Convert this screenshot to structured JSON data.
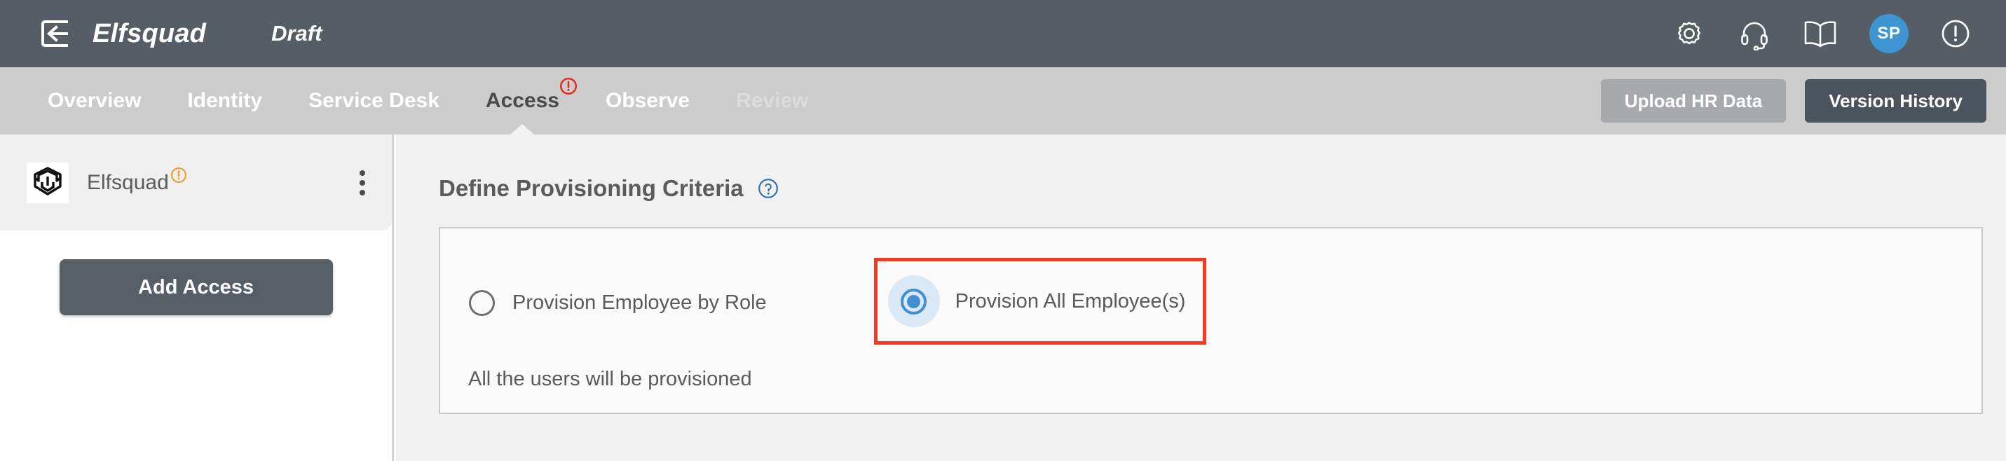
{
  "header": {
    "back_icon": "back-arrow-box-icon",
    "brand": "Elfsquad",
    "status": "Draft",
    "icons": [
      {
        "name": "gear-icon",
        "label": "Settings"
      },
      {
        "name": "headset-icon",
        "label": "Support"
      },
      {
        "name": "book-icon",
        "label": "Documentation"
      }
    ],
    "avatar_initials": "SP",
    "alert_icon": "exclamation-circle-icon"
  },
  "nav": {
    "tabs": [
      {
        "label": "Overview",
        "state": "normal"
      },
      {
        "label": "Identity",
        "state": "normal"
      },
      {
        "label": "Service Desk",
        "state": "normal"
      },
      {
        "label": "Access",
        "state": "active",
        "warning": true
      },
      {
        "label": "Observe",
        "state": "normal"
      },
      {
        "label": "Review",
        "state": "disabled"
      }
    ],
    "actions": {
      "upload_label": "Upload HR Data",
      "version_label": "Version History"
    }
  },
  "sidebar": {
    "org": {
      "logo_icon": "elfsquad-shield-logo-icon",
      "name": "Elfsquad",
      "warning_icon": "warning-circle-icon"
    },
    "menu_icon": "kebab-menu-icon",
    "add_access_label": "Add Access"
  },
  "main": {
    "title": "Define Provisioning Criteria",
    "help_icon": "question-circle-icon",
    "options": [
      {
        "label": "Provision Employee by Role",
        "selected": false
      },
      {
        "label": "Provision All Employee(s)",
        "selected": true
      }
    ],
    "helper_text": "All the users will be provisioned"
  },
  "colors": {
    "header_bg": "#555d66",
    "nav_bg": "#cccccc",
    "accent_blue": "#3f8fd2",
    "annotation_red": "#ef3b21",
    "warning_orange": "#f0a030",
    "tab_warning_red": "#e8251b",
    "button_dark": "#4a545e",
    "button_gray": "#a7a9ac"
  }
}
